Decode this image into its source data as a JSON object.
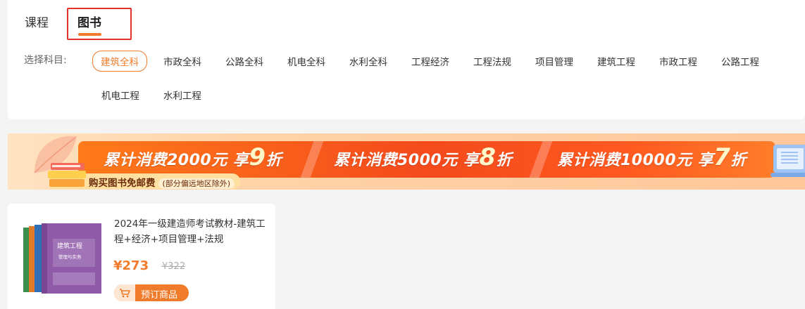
{
  "tabs": {
    "courses": "课程",
    "books": "图书"
  },
  "filter": {
    "label": "选择科目:",
    "subjects": [
      "建筑全科",
      "市政全科",
      "公路全科",
      "机电全科",
      "水利全科",
      "工程经济",
      "工程法规",
      "项目管理",
      "建筑工程",
      "市政工程",
      "公路工程",
      "机电工程",
      "水利工程"
    ],
    "active_subject": "建筑全科"
  },
  "banner": {
    "segments": [
      {
        "prefix": "累计消费2000元 享",
        "discount": "9",
        "suffix": "折"
      },
      {
        "prefix": "累计消费5000元 享",
        "discount": "8",
        "suffix": "折"
      },
      {
        "prefix": "累计消费10000元 享",
        "discount": "7",
        "suffix": "折"
      }
    ],
    "free_shipping": "购买图书免邮费",
    "free_shipping_note": "(部分偏远地区除外)"
  },
  "product": {
    "title": "2024年一级建造师考试教材-建筑工程+经济+项目管理+法规",
    "price": "¥273",
    "original_price": "¥322",
    "button": "预订商品",
    "cover_text_1": "建筑工程",
    "cover_text_2": "管理与实务"
  },
  "colors": {
    "accent": "#f07b2a",
    "highlight_border": "#e4312b",
    "banner_red": "#f44a1c"
  }
}
